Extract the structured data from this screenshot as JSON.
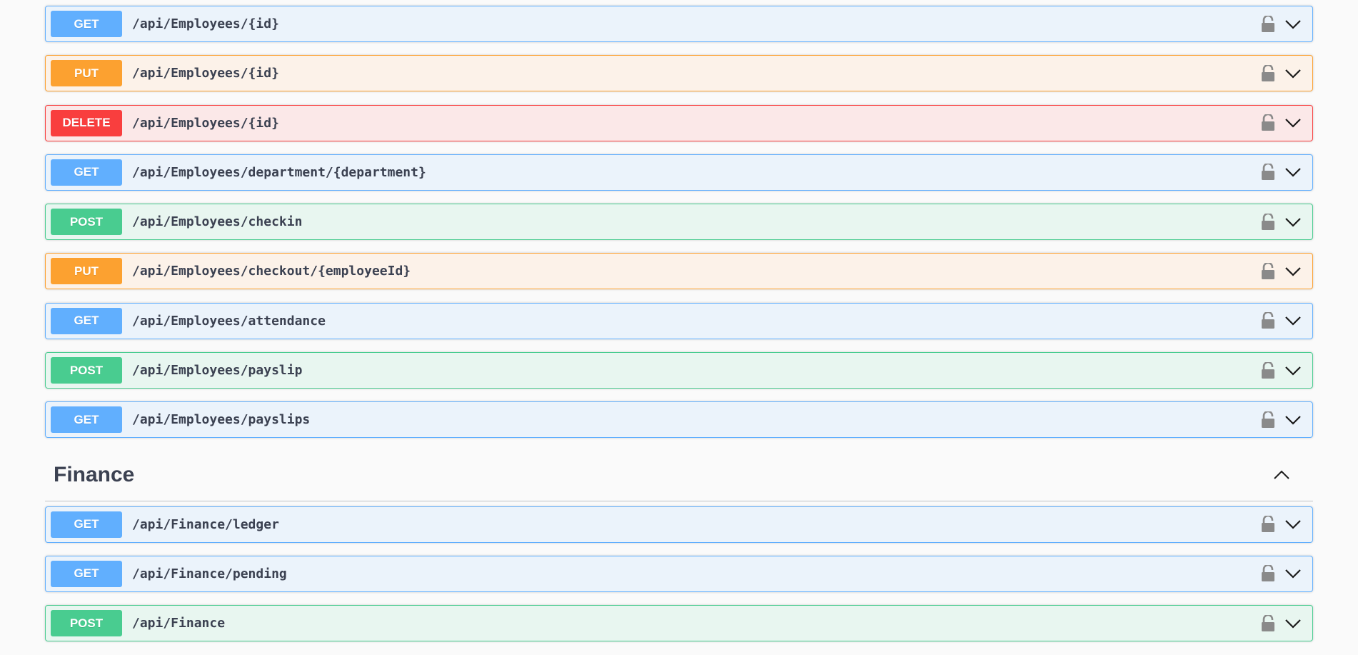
{
  "colors": {
    "get": "#61affe",
    "put": "#fca130",
    "delete": "#f93e3e",
    "post": "#49cc90",
    "text": "#3b4151"
  },
  "operations_before": [
    {
      "method": "GET",
      "path": "/api/Employees/{id}"
    },
    {
      "method": "PUT",
      "path": "/api/Employees/{id}"
    },
    {
      "method": "DELETE",
      "path": "/api/Employees/{id}"
    },
    {
      "method": "GET",
      "path": "/api/Employees/department/{department}"
    },
    {
      "method": "POST",
      "path": "/api/Employees/checkin"
    },
    {
      "method": "PUT",
      "path": "/api/Employees/checkout/{employeeId}"
    },
    {
      "method": "GET",
      "path": "/api/Employees/attendance"
    },
    {
      "method": "POST",
      "path": "/api/Employees/payslip"
    },
    {
      "method": "GET",
      "path": "/api/Employees/payslips"
    }
  ],
  "finance": {
    "title": "Finance",
    "toggle_icon": "chevron-up-icon",
    "operations": [
      {
        "method": "GET",
        "path": "/api/Finance/ledger"
      },
      {
        "method": "GET",
        "path": "/api/Finance/pending"
      },
      {
        "method": "POST",
        "path": "/api/Finance"
      }
    ]
  },
  "row_icons": [
    "lock-icon",
    "chevron-down-icon"
  ]
}
